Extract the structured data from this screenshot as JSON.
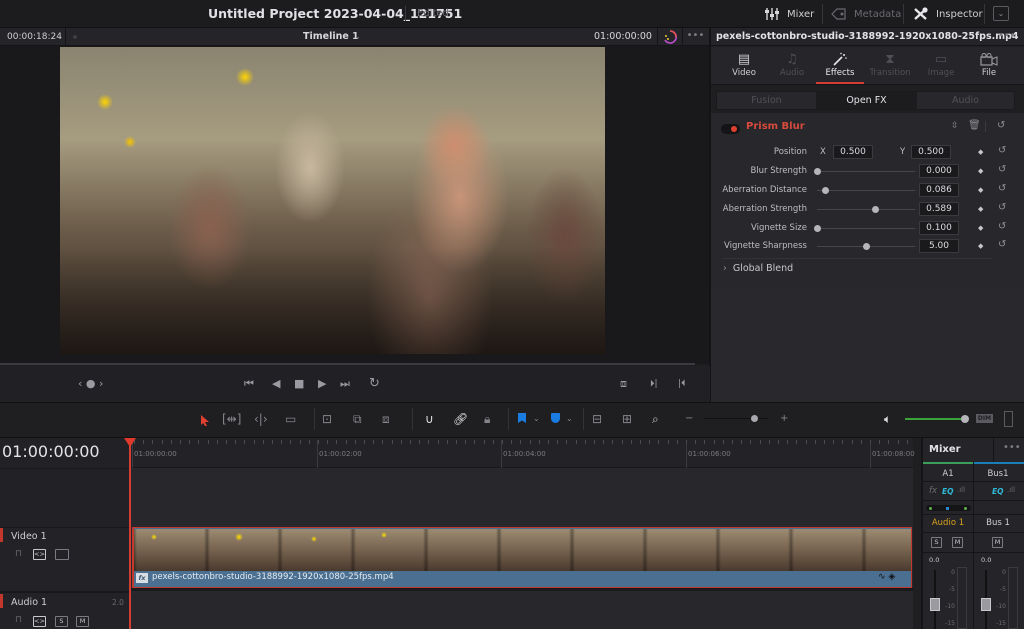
{
  "title_bar": {
    "project_title": "Untitled Project 2023-04-04_121751",
    "project_status": "Edited",
    "buttons": [
      {
        "label": "Mixer",
        "icon": "mixer-sliders-icon"
      },
      {
        "label": "Metadata",
        "icon": "metadata-tag-icon"
      },
      {
        "label": "Inspector",
        "icon": "inspector-tools-icon"
      }
    ],
    "expand_icon": "⌄"
  },
  "viewer": {
    "source_timecode": "00:00:18:24",
    "timeline_name": "Timeline 1",
    "timeline_chevron": "⌄",
    "record_timecode": "01:00:00:00",
    "more": "•••",
    "transport": {
      "jog": "‹ ● ›",
      "first_frame": "⏮",
      "reverse": "◀",
      "stop": "■",
      "play": "▶",
      "last_frame": "⏭",
      "loop": "↻",
      "match_frame": "⧈",
      "mark_in": "⏵|",
      "mark_out": "|⏴"
    }
  },
  "inspector": {
    "clip_name": "pexels-cottonbro-studio-3188992-1920x1080-25fps.mp4",
    "more": "•••",
    "tabs": [
      {
        "label": "Video",
        "icon": "▤",
        "state": "on"
      },
      {
        "label": "Audio",
        "icon": "♫",
        "state": "dim"
      },
      {
        "label": "Effects",
        "icon": "✨",
        "state": "active"
      },
      {
        "label": "Transition",
        "icon": "⧗",
        "state": "dim"
      },
      {
        "label": "Image",
        "icon": "▭",
        "state": "dim"
      },
      {
        "label": "File",
        "icon": "🎞",
        "state": "on"
      }
    ],
    "subtabs": [
      {
        "label": "Fusion",
        "active": false
      },
      {
        "label": "Open FX",
        "active": true
      },
      {
        "label": "Audio",
        "active": false
      }
    ],
    "effect": {
      "name": "Prism Blur",
      "enabled": true,
      "accent_color": "#d84a3c",
      "position": {
        "label": "Position",
        "x_label": "X",
        "x": "0.500",
        "y_label": "Y",
        "y": "0.500"
      },
      "params": [
        {
          "label": "Blur Strength",
          "value": "0.000",
          "slider_fraction": 0.0
        },
        {
          "label": "Aberration Distance",
          "value": "0.086",
          "slider_fraction": 0.086
        },
        {
          "label": "Aberration Strength",
          "value": "0.589",
          "slider_fraction": 0.589
        },
        {
          "label": "Vignette Size",
          "value": "0.100",
          "slider_fraction": 0.0
        },
        {
          "label": "Vignette Sharpness",
          "value": "5.00",
          "slider_fraction": 0.5
        }
      ],
      "keyframe_icon": "◆",
      "reset_icon": "↺"
    },
    "global_blend": {
      "chevron": "›",
      "label": "Global Blend"
    }
  },
  "timeline_toolbar": {
    "tools": [
      "selection-arrow",
      "trim-edit",
      "dynamic-trim",
      "blade-edit",
      "insert-clip",
      "overwrite-clip",
      "replace-clip",
      "snapping",
      "linked-selection",
      "position-lock",
      "flag",
      "marker",
      "zoom-full",
      "zoom-detail",
      "zoom-custom"
    ],
    "zoom_slider_fraction": 0.78,
    "zoom_minus": "−",
    "zoom_plus": "+",
    "volume_fraction": 1.0,
    "dim_label": "DIM"
  },
  "timeline": {
    "timecode": "01:00:00:00",
    "ruler_labels": [
      "01:00:00:00",
      "01:00:02:00",
      "01:00:04:00",
      "01:00:06:00",
      "01:00:08:00"
    ],
    "tracks": [
      {
        "name": "Video 1",
        "type": "video"
      },
      {
        "name": "Audio 1",
        "type": "audio",
        "channels": "2.0",
        "solo": "S",
        "mute": "M"
      }
    ],
    "clip": {
      "name": "pexels-cottonbro-studio-3188992-1920x1080-25fps.mp4",
      "fx_badge": "fx"
    }
  },
  "mixer": {
    "title": "Mixer",
    "more": "•••",
    "channels": [
      {
        "id": "A1",
        "fx": "fx",
        "eq": "EQ",
        "name": "Audio 1",
        "solo": "S",
        "mute": "M",
        "level": "0.0",
        "name_color": "#d6a21e"
      },
      {
        "id": "Bus1",
        "eq": "EQ",
        "name": "Bus 1",
        "mute": "M",
        "level": "0.0"
      }
    ],
    "scale": [
      "0",
      "-5",
      "-10",
      "-15"
    ]
  }
}
